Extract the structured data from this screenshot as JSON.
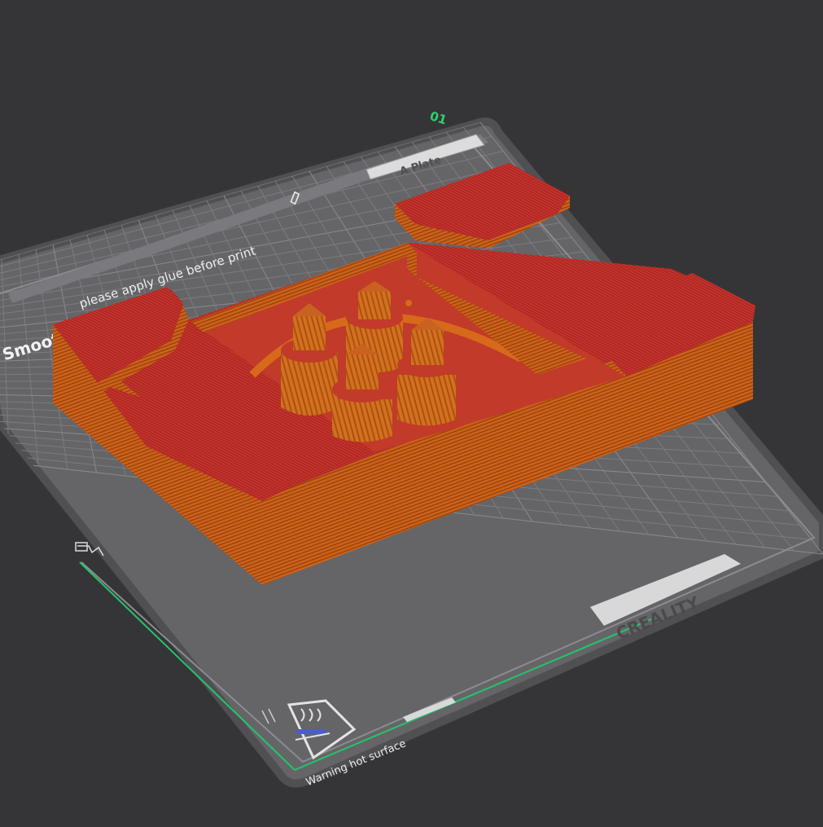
{
  "plate": {
    "index": "01",
    "name": "A Plate",
    "surface": "Smooth PEI Plate",
    "notice": "please apply glue before print",
    "brand": "CREALITY",
    "warning": "Warning hot surface"
  },
  "colors": {
    "background": "#353538",
    "bed": "#656568",
    "bed_border": "#505053",
    "grid": "#7c7c80",
    "x_axis": "#23c56a",
    "plate_index": "#2fd16b",
    "model_side": "#d0651a",
    "model_top": "#c1302b"
  },
  "icons": [
    "edit-icon",
    "warning-hot-surface-icon",
    "bed-origin-icon"
  ]
}
